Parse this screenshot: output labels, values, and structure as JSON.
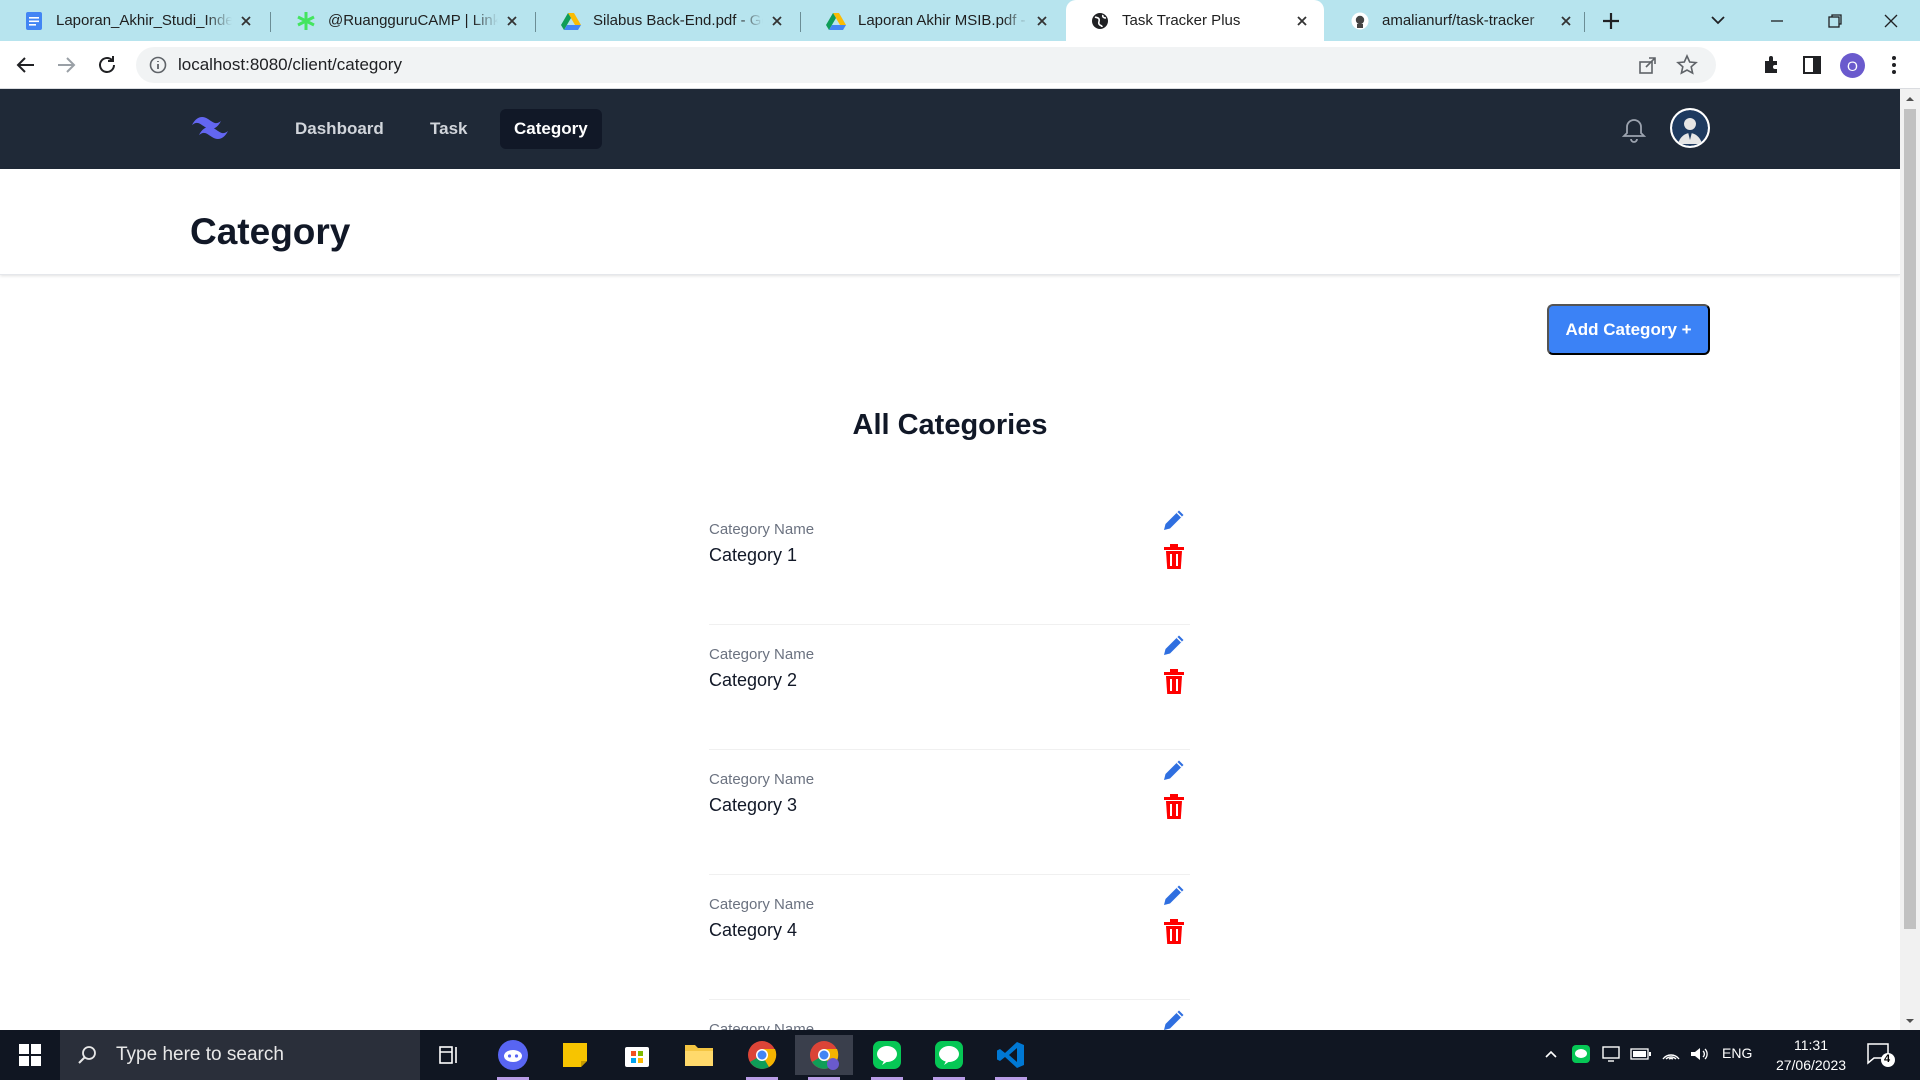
{
  "browser": {
    "tabs": [
      {
        "title": "Laporan_Akhir_Studi_Independen",
        "icon": "google-docs-icon",
        "active": false
      },
      {
        "title": "@RuangguruCAMP | Linktree",
        "icon": "linktree-icon",
        "active": false
      },
      {
        "title": "Silabus Back-End.pdf - Google Drive",
        "icon": "google-drive-icon",
        "active": false
      },
      {
        "title": "Laporan Akhir MSIB.pdf - Google Drive",
        "icon": "google-drive-icon",
        "active": false
      },
      {
        "title": "Task Tracker Plus",
        "icon": "globe-icon",
        "active": true
      },
      {
        "title": "amalianurf/task-tracker",
        "icon": "github-icon",
        "active": false
      }
    ],
    "url": "localhost:8080/client/category",
    "profile_initial": "O"
  },
  "app": {
    "nav": {
      "links": [
        {
          "label": "Dashboard",
          "active": false
        },
        {
          "label": "Task",
          "active": false
        },
        {
          "label": "Category",
          "active": true
        }
      ]
    },
    "page_title": "Category",
    "add_button_label": "Add Category +",
    "list_heading": "All Categories",
    "categories": [
      {
        "label": "Category Name",
        "name": "Category 1"
      },
      {
        "label": "Category Name",
        "name": "Category 2"
      },
      {
        "label": "Category Name",
        "name": "Category 3"
      },
      {
        "label": "Category Name",
        "name": "Category 4"
      },
      {
        "label": "Category Name",
        "name": ""
      }
    ],
    "colors": {
      "nav_bg": "#1f2937",
      "primary": "#3b82f6",
      "danger": "#ff0000",
      "edit": "#2f6fe0"
    }
  },
  "taskbar": {
    "search_placeholder": "Type here to search",
    "language": "ENG",
    "time": "11:31",
    "date": "27/06/2023",
    "notification_count": "4",
    "apps": [
      "task-view-icon",
      "discord-icon",
      "sticky-notes-icon",
      "microsoft-store-icon",
      "file-explorer-icon",
      "chrome-icon",
      "chrome-profile-icon",
      "line-icon",
      "line-icon",
      "vscode-icon"
    ]
  }
}
